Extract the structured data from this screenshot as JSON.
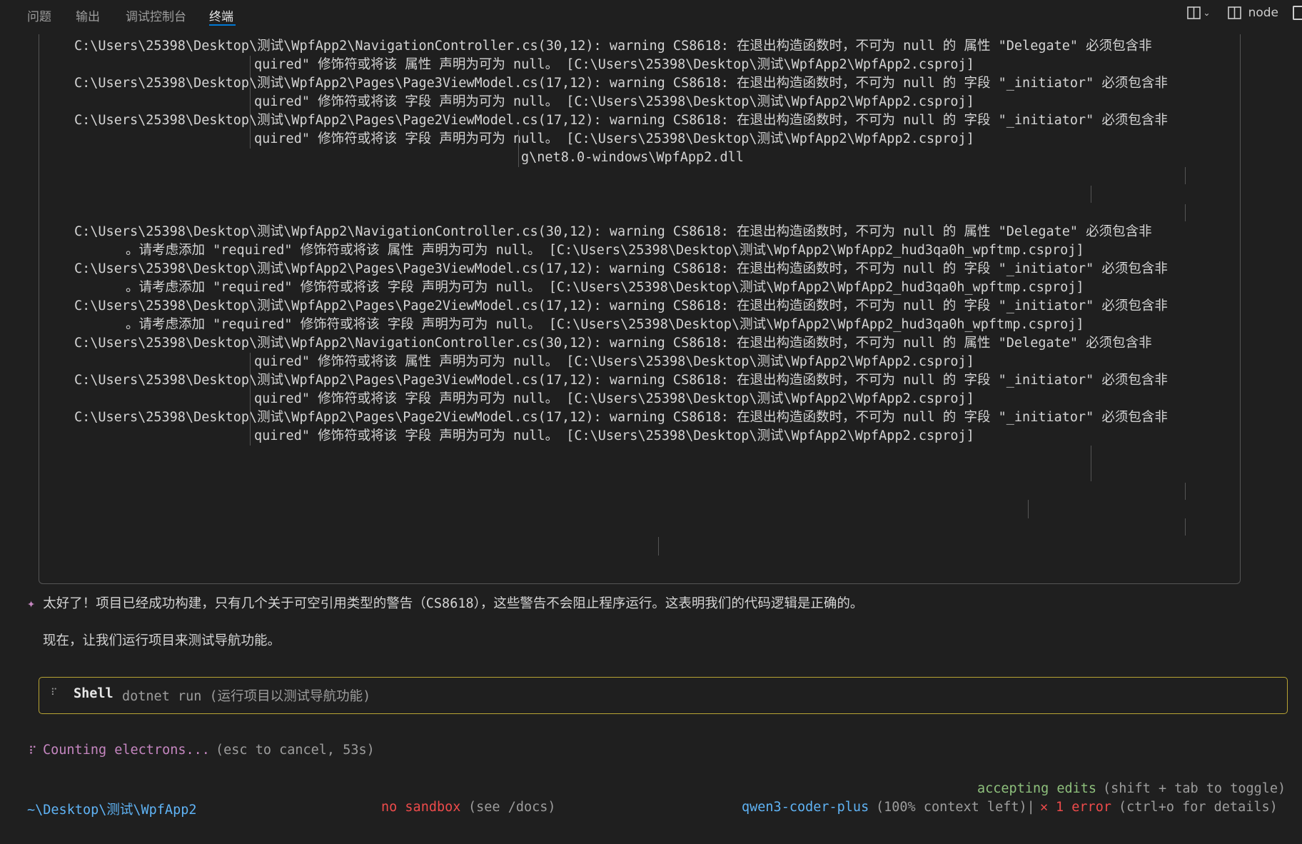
{
  "panel": {
    "tabs": [
      "问题",
      "输出",
      "调试控制台",
      "终端"
    ],
    "active_tab": "终端",
    "terminal_name": "node"
  },
  "log": {
    "block1": [
      "C:\\Users\\25398\\Desktop\\测试\\WpfApp2\\NavigationController.cs(30,12): warning CS8618: 在退出构造函数时，不可为 null 的 属性 \"Delegate\" 必须包含非",
      "quired\" 修饰符或将该 属性 声明为可为 null。 [C:\\Users\\25398\\Desktop\\测试\\WpfApp2\\WpfApp2.csproj]",
      "C:\\Users\\25398\\Desktop\\测试\\WpfApp2\\Pages\\Page3ViewModel.cs(17,12): warning CS8618: 在退出构造函数时，不可为 null 的 字段 \"_initiator\" 必须包含非",
      "quired\" 修饰符或将该 字段 声明为可为 null。 [C:\\Users\\25398\\Desktop\\测试\\WpfApp2\\WpfApp2.csproj]",
      "C:\\Users\\25398\\Desktop\\测试\\WpfApp2\\Pages\\Page2ViewModel.cs(17,12): warning CS8618: 在退出构造函数时，不可为 null 的 字段 \"_initiator\" 必须包含非",
      "quired\" 修饰符或将该 字段 声明为可为 null。 [C:\\Users\\25398\\Desktop\\测试\\WpfApp2\\WpfApp2.csproj]",
      "g\\net8.0-windows\\WpfApp2.dll"
    ],
    "block2": [
      "C:\\Users\\25398\\Desktop\\测试\\WpfApp2\\NavigationController.cs(30,12): warning CS8618: 在退出构造函数时，不可为 null 的 属性 \"Delegate\" 必须包含非",
      "。请考虑添加 \"required\" 修饰符或将该 属性 声明为可为 null。 [C:\\Users\\25398\\Desktop\\测试\\WpfApp2\\WpfApp2_hud3qa0h_wpftmp.csproj]",
      "C:\\Users\\25398\\Desktop\\测试\\WpfApp2\\Pages\\Page3ViewModel.cs(17,12): warning CS8618: 在退出构造函数时，不可为 null 的 字段 \"_initiator\" 必须包含非",
      "。请考虑添加 \"required\" 修饰符或将该 字段 声明为可为 null。 [C:\\Users\\25398\\Desktop\\测试\\WpfApp2\\WpfApp2_hud3qa0h_wpftmp.csproj]",
      "C:\\Users\\25398\\Desktop\\测试\\WpfApp2\\Pages\\Page2ViewModel.cs(17,12): warning CS8618: 在退出构造函数时，不可为 null 的 字段 \"_initiator\" 必须包含非",
      "。请考虑添加 \"required\" 修饰符或将该 字段 声明为可为 null。 [C:\\Users\\25398\\Desktop\\测试\\WpfApp2\\WpfApp2_hud3qa0h_wpftmp.csproj]",
      "C:\\Users\\25398\\Desktop\\测试\\WpfApp2\\NavigationController.cs(30,12): warning CS8618: 在退出构造函数时，不可为 null 的 属性 \"Delegate\" 必须包含非",
      "quired\" 修饰符或将该 属性 声明为可为 null。 [C:\\Users\\25398\\Desktop\\测试\\WpfApp2\\WpfApp2.csproj]",
      "C:\\Users\\25398\\Desktop\\测试\\WpfApp2\\Pages\\Page3ViewModel.cs(17,12): warning CS8618: 在退出构造函数时，不可为 null 的 字段 \"_initiator\" 必须包含非",
      "quired\" 修饰符或将该 字段 声明为可为 null。 [C:\\Users\\25398\\Desktop\\测试\\WpfApp2\\WpfApp2.csproj]",
      "C:\\Users\\25398\\Desktop\\测试\\WpfApp2\\Pages\\Page2ViewModel.cs(17,12): warning CS8618: 在退出构造函数时，不可为 null 的 字段 \"_initiator\" 必须包含非",
      "quired\" 修饰符或将该 字段 声明为可为 null。 [C:\\Users\\25398\\Desktop\\测试\\WpfApp2\\WpfApp2.csproj]"
    ]
  },
  "assistant": {
    "icon": "✦",
    "message1": "太好了！项目已经成功构建，只有几个关于可空引用类型的警告（CS8618），这些警告不会阻止程序运行。这表明我们的代码逻辑是正确的。",
    "message2": "现在，让我们运行项目来测试导航功能。"
  },
  "tool_call": {
    "icon": "⠏",
    "name": "Shell",
    "command": "dotnet run (运行项目以测试导航功能)"
  },
  "status": {
    "spinner": "⠏",
    "text": "Counting electrons...",
    "hint": "(esc to cancel, 53s)"
  },
  "footer": {
    "mode": "accepting edits",
    "mode_hint": "(shift + tab to toggle)",
    "cwd": "~\\Desktop\\测试\\WpfApp2",
    "sandbox": "no sandbox",
    "sandbox_hint": "(see /docs)",
    "model": "qwen3-coder-plus",
    "context": "(100% context left)|",
    "error_icon": "✕",
    "error": "1 error",
    "error_hint": "(ctrl+o for details)"
  }
}
